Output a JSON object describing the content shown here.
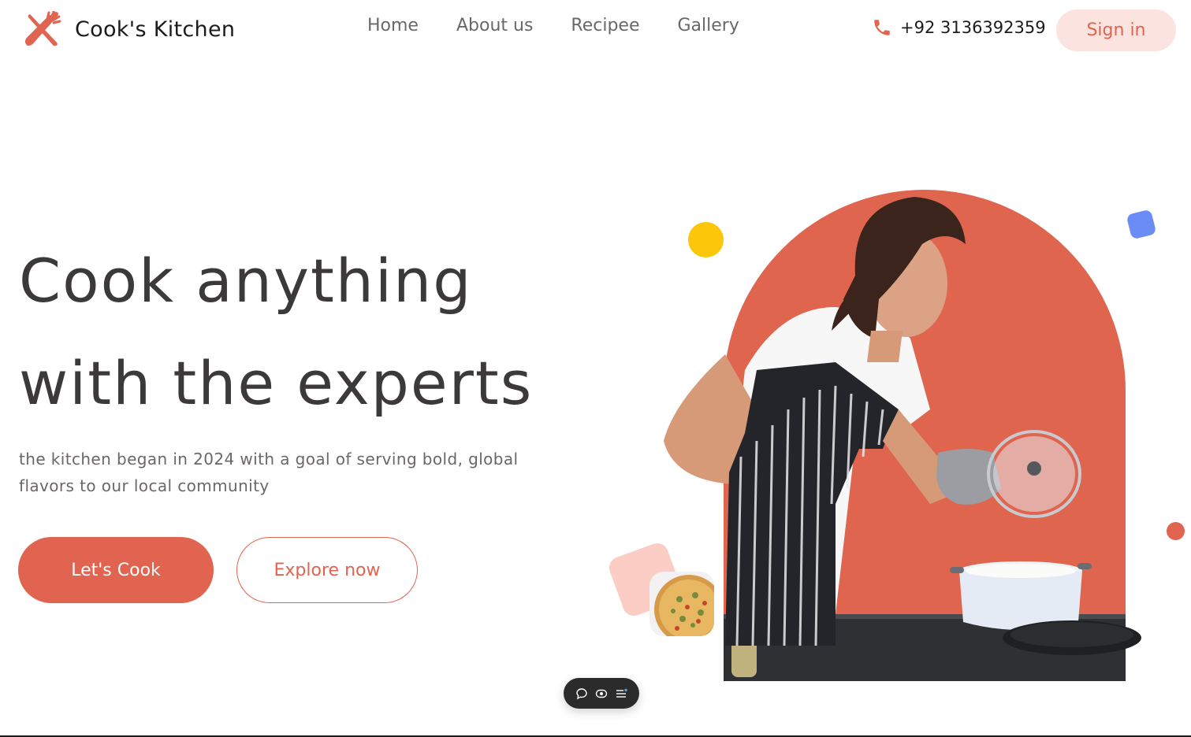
{
  "brand": {
    "name": "Cook's Kitchen",
    "logo_icon": "fork-knife-cross-icon"
  },
  "nav": {
    "items": [
      {
        "label": "Home"
      },
      {
        "label": "About us"
      },
      {
        "label": "Recipee"
      },
      {
        "label": "Gallery"
      }
    ]
  },
  "contact": {
    "phone": "+92 3136392359",
    "icon": "phone-icon"
  },
  "auth": {
    "signin_label": "Sign in"
  },
  "hero": {
    "title_line1": "Cook anything",
    "title_line2": "with the experts",
    "subtitle": "the kitchen began in 2024 with a goal of serving bold, global flavors to our local community",
    "primary_cta": "Let's Cook",
    "secondary_cta": "Explore now",
    "image_subject": "woman cooking in striped apron",
    "thumbnail_subject": "pizza"
  },
  "toolbar": {
    "icons": [
      "comment-icon",
      "eye-icon",
      "menu-icon"
    ]
  },
  "colors": {
    "accent": "#e0644f",
    "accent_soft": "#fbe3df",
    "yellow": "#fcc70a",
    "blue": "#6c8cf5",
    "pink": "#fccdc5",
    "text_dark": "#3b393a",
    "text_muted": "#6b6768"
  }
}
